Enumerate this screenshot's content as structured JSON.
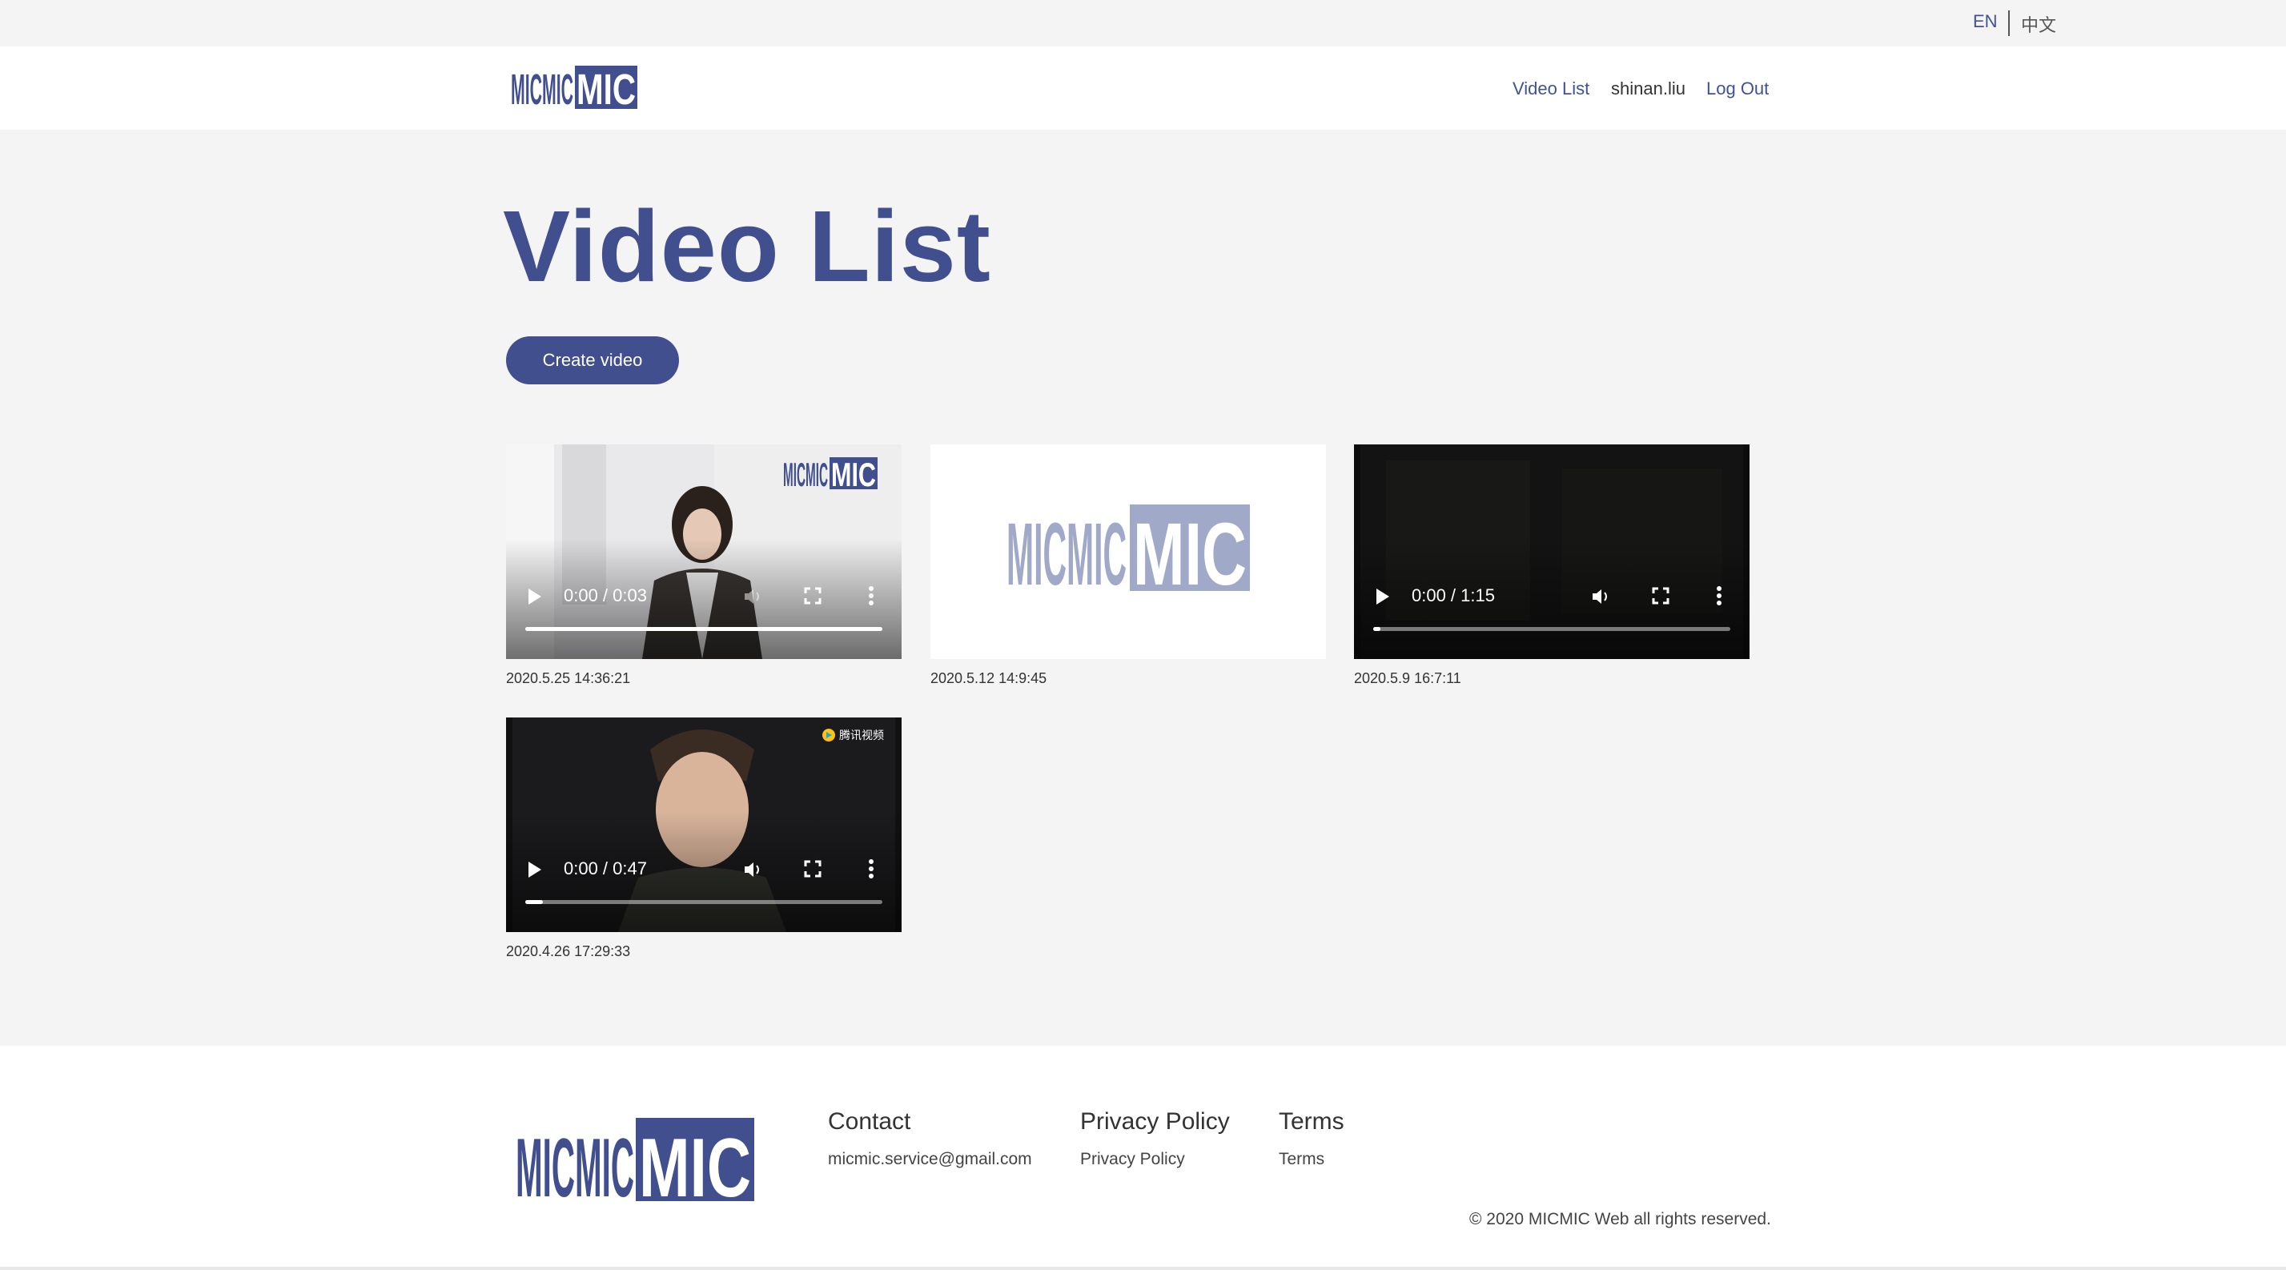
{
  "lang": {
    "en": "EN",
    "zh": "中文"
  },
  "header": {
    "logo": "MICMIC",
    "nav": {
      "video_list": "Video List",
      "user": "shinan.liu",
      "logout": "Log Out"
    }
  },
  "main": {
    "title": "Video List",
    "create_button": "Create video",
    "videos": [
      {
        "time": "0:00 / 0:03",
        "date": "2020.5.25 14:36:21",
        "watermark": "MICMIC"
      },
      {
        "date": "2020.5.12 14:9:45",
        "placeholder": "MICMIC"
      },
      {
        "time": "0:00 / 1:15",
        "date": "2020.5.9 16:7:11"
      },
      {
        "time": "0:00 / 0:47",
        "date": "2020.4.26 17:29:33",
        "watermark": "腾讯视频"
      }
    ]
  },
  "footer": {
    "logo": "MICMIC",
    "contact": {
      "heading": "Contact",
      "email": "micmic.service@gmail.com"
    },
    "privacy": {
      "heading": "Privacy Policy",
      "link": "Privacy Policy"
    },
    "terms": {
      "heading": "Terms",
      "link": "Terms"
    },
    "copyright": "© 2020 MICMIC Web all rights reserved."
  },
  "colors": {
    "brand": "#414f8e",
    "link": "#3f5294",
    "background": "#f4f4f4"
  }
}
